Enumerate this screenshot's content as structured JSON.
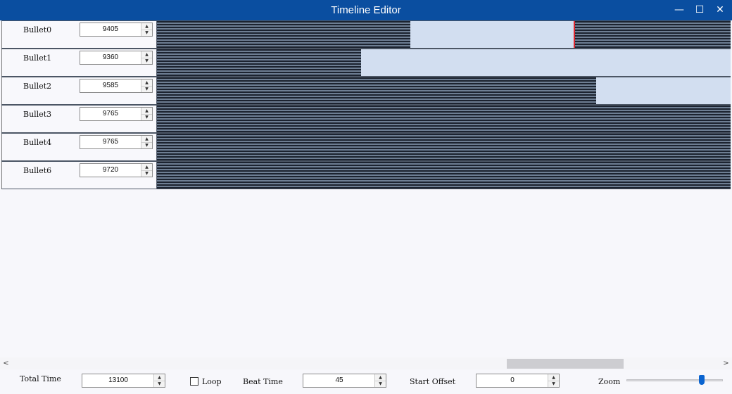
{
  "window": {
    "title": "Timeline Editor",
    "minimize_glyph": "—",
    "maximize_glyph": "☐",
    "close_glyph": "✕"
  },
  "timeline": {
    "start_value": 9000,
    "value_per_pixel": 0.5,
    "tracks": [
      {
        "name": "Bullet0",
        "value": "9405",
        "clip_start": 9180,
        "clip_end": 9297
      },
      {
        "name": "Bullet1",
        "value": "9360",
        "clip_start": 9145,
        "clip_end": 9549
      },
      {
        "name": "Bullet2",
        "value": "9585",
        "clip_start": 9312,
        "clip_end": 9446
      },
      {
        "name": "Bullet3",
        "value": "9765",
        "clip_start": 9449,
        "clip_end": 9617
      },
      {
        "name": "Bullet4",
        "value": "9765",
        "clip_start": 9449,
        "clip_end": 9617
      },
      {
        "name": "Bullet6",
        "value": "9720",
        "clip_start": 9415,
        "clip_end": 9617
      }
    ],
    "colors": {
      "grid_bg": "#6e7e93",
      "clip_fill": "#d2def0",
      "clip_end_marker": "#e0252c"
    }
  },
  "scrollbar": {
    "left_arrow": "<",
    "right_arrow": ">"
  },
  "controls": {
    "total_time_label": "Total Time",
    "total_time_value": "13100",
    "loop_label": "Loop",
    "loop_checked": false,
    "beat_time_label": "Beat Time",
    "beat_time_value": "45",
    "start_offset_label": "Start Offset",
    "start_offset_value": "0",
    "zoom_label": "Zoom",
    "zoom_level": 0.78
  },
  "spinner": {
    "up_glyph": "▲",
    "down_glyph": "▼"
  },
  "accent_color": "#0a64d0"
}
